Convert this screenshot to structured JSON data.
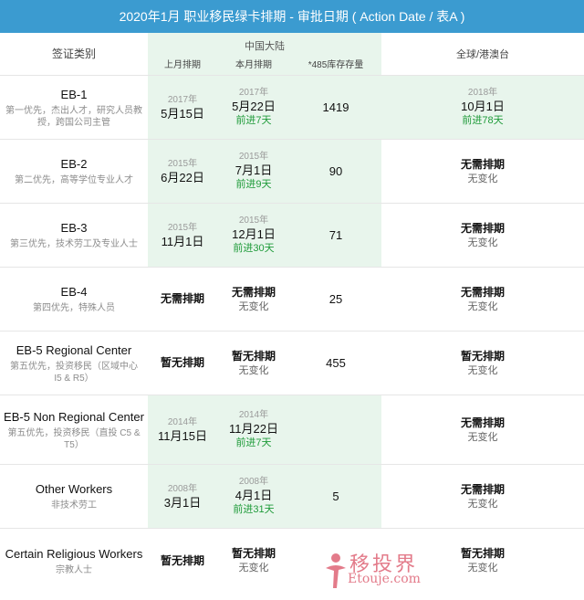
{
  "title": "2020年1月 职业移民绿卡排期 - 审批日期 ( Action Date / 表A )",
  "header": {
    "category_label": "签证类别",
    "mainland_label": "中国大陆",
    "last_month_label": "上月排期",
    "this_month_label": "本月排期",
    "inventory_label": "*485库存存量",
    "global_label": "全球/港澳台"
  },
  "rows": [
    {
      "name": "EB-1",
      "desc": "第一优先，杰出人才，研究人员教授，跨国公司主管",
      "last": {
        "year": "2017年",
        "date": "5月15日"
      },
      "this": {
        "year": "2017年",
        "date": "5月22日",
        "adv": "前进7天"
      },
      "inventory": "1419",
      "global": {
        "year": "2018年",
        "date": "10月1日",
        "adv": "前进78天"
      }
    },
    {
      "name": "EB-2",
      "desc": "第二优先，高等学位专业人才",
      "last": {
        "year": "2015年",
        "date": "6月22日"
      },
      "this": {
        "year": "2015年",
        "date": "7月1日",
        "adv": "前进9天"
      },
      "inventory": "90",
      "global": {
        "status": "无需排期",
        "note": "无变化"
      }
    },
    {
      "name": "EB-3",
      "desc": "第三优先，技术劳工及专业人士",
      "last": {
        "year": "2015年",
        "date": "11月1日"
      },
      "this": {
        "year": "2015年",
        "date": "12月1日",
        "adv": "前进30天"
      },
      "inventory": "71",
      "global": {
        "status": "无需排期",
        "note": "无变化"
      }
    },
    {
      "name": "EB-4",
      "desc": "第四优先，特殊人员",
      "last": {
        "status": "无需排期"
      },
      "this": {
        "status": "无需排期",
        "note": "无变化"
      },
      "inventory": "25",
      "global": {
        "status": "无需排期",
        "note": "无变化"
      }
    },
    {
      "name": "EB-5 Regional Center",
      "desc": "第五优先，投资移民（区域中心 I5 & R5）",
      "last": {
        "status": "暂无排期"
      },
      "this": {
        "status": "暂无排期",
        "note": "无变化"
      },
      "inventory": "455",
      "global": {
        "status": "暂无排期",
        "note": "无变化"
      }
    },
    {
      "name": "EB-5 Non Regional Center",
      "desc": "第五优先，投资移民（直投 C5 & T5）",
      "last": {
        "year": "2014年",
        "date": "11月15日"
      },
      "this": {
        "year": "2014年",
        "date": "11月22日",
        "adv": "前进7天"
      },
      "inventory": "",
      "global": {
        "status": "无需排期",
        "note": "无变化"
      }
    },
    {
      "name": "Other Workers",
      "desc": "非技术劳工",
      "last": {
        "year": "2008年",
        "date": "3月1日"
      },
      "this": {
        "year": "2008年",
        "date": "4月1日",
        "adv": "前进31天"
      },
      "inventory": "5",
      "global": {
        "status": "无需排期",
        "note": "无变化"
      }
    },
    {
      "name": "Certain Religious Workers",
      "desc": "宗教人士",
      "last": {
        "status": "暂无排期"
      },
      "this": {
        "status": "暂无排期",
        "note": "无变化"
      },
      "inventory": "",
      "global": {
        "status": "暂无排期",
        "note": "无变化"
      }
    }
  ],
  "watermark": {
    "cn": "移投界",
    "en": "Etouje.com"
  }
}
